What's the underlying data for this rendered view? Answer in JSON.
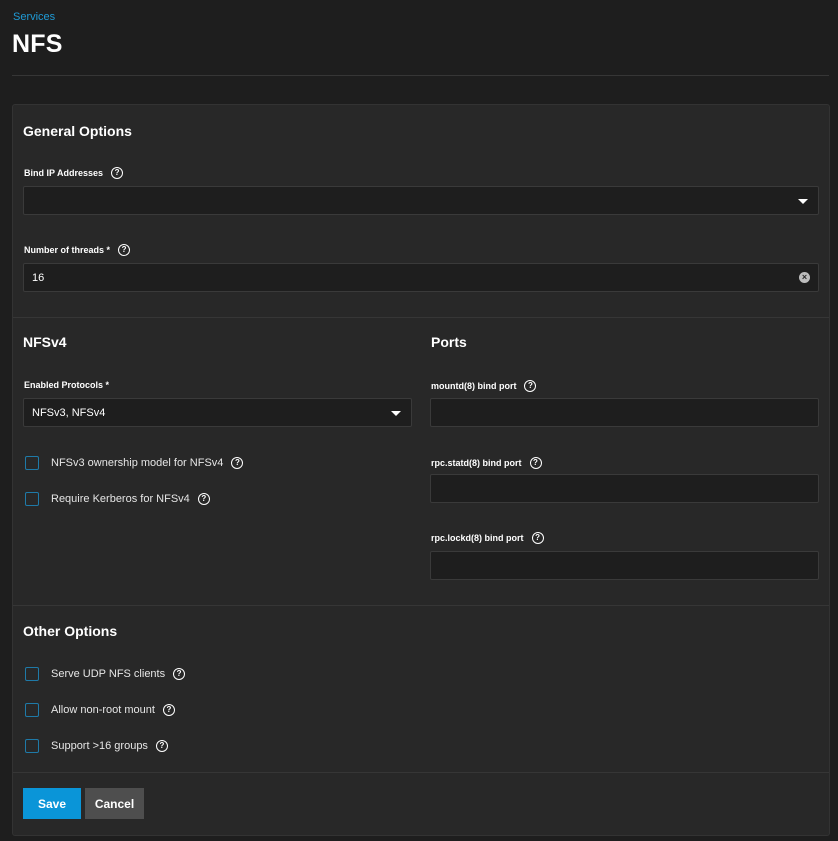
{
  "breadcrumb": "Services",
  "page_title": "NFS",
  "general": {
    "title": "General Options",
    "bind_ip_label": "Bind IP Addresses",
    "bind_ip_value": "",
    "threads_label": "Number of threads",
    "threads_required": "*",
    "threads_value": "16"
  },
  "nfsv4": {
    "title": "NFSv4",
    "protocols_label": "Enabled Protocols",
    "protocols_required": "*",
    "protocols_value": "NFSv3, NFSv4",
    "checkbox_ownership": "NFSv3 ownership model for NFSv4",
    "checkbox_kerberos": "Require Kerberos for NFSv4"
  },
  "ports": {
    "title": "Ports",
    "mountd_label": "mountd(8) bind port",
    "statd_label": "rpc.statd(8) bind port",
    "lockd_label": "rpc.lockd(8) bind port"
  },
  "other": {
    "title": "Other Options",
    "checkbox_udp": "Serve UDP NFS clients",
    "checkbox_nonroot": "Allow non-root mount",
    "checkbox_groups": "Support >16 groups"
  },
  "actions": {
    "save": "Save",
    "cancel": "Cancel"
  },
  "help_glyph": "?",
  "clear_glyph": "×",
  "colors": {
    "accent": "#0a95d8",
    "link": "#1f9bd6",
    "background": "#1e1e1e",
    "card": "#282828"
  }
}
